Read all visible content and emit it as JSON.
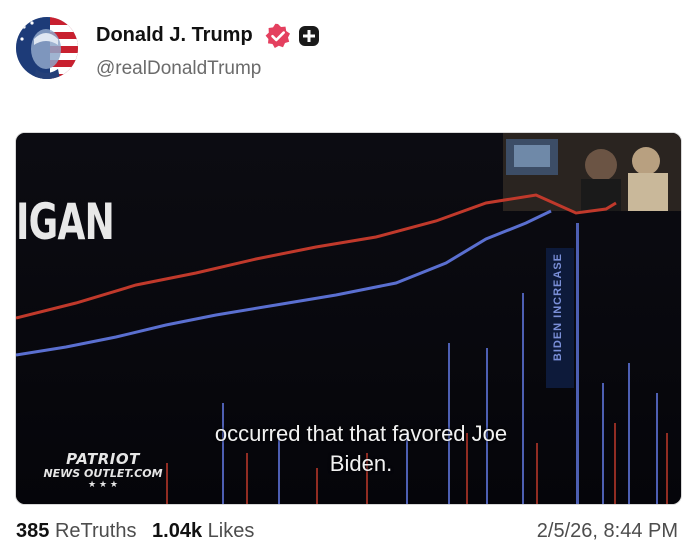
{
  "post": {
    "author_name": "Donald J. Trump",
    "handle": "@realDonaldTrump",
    "verified_icon": "verified-check-icon",
    "plus_icon": "plus-badge-icon"
  },
  "video": {
    "overlay_label": "IGAN",
    "vertical_label": "BIDEN INCREASE",
    "caption_line1": "occurred that that favored Joe",
    "caption_line2": "Biden.",
    "watermark_line1": "PATRIOT",
    "watermark_line2": "NEWS OUTLET.COM",
    "watermark_stars": "★ ★ ★"
  },
  "stats": {
    "retruths_count": "385",
    "retruths_label": "ReTruths",
    "likes_count": "1.04k",
    "likes_label": "Likes",
    "timestamp": "2/5/26, 8:44 PM"
  },
  "colors": {
    "verified_badge": "#e4405f",
    "red_line": "#c0392b",
    "blue_line": "#5a6fd0"
  }
}
